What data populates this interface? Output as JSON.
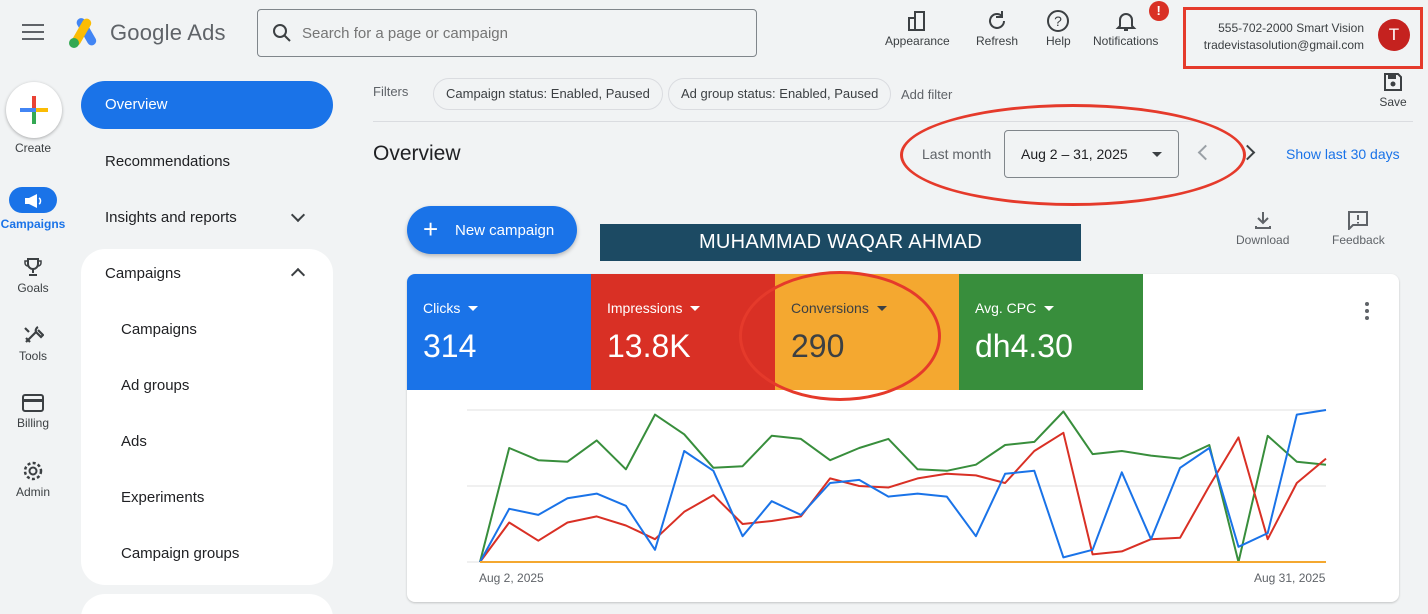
{
  "app": {
    "name": "Google Ads",
    "search_placeholder": "Search for a page or campaign"
  },
  "top_actions": [
    {
      "label": "Appearance",
      "icon": "appearance-icon"
    },
    {
      "label": "Refresh",
      "icon": "refresh-icon"
    },
    {
      "label": "Help",
      "icon": "help-icon"
    },
    {
      "label": "Notifications",
      "icon": "bell-icon",
      "badge": "!"
    }
  ],
  "account": {
    "line1": "555-702-2000 Smart Vision",
    "email": "tradevistasolution@gmail.com",
    "avatar_letter": "T"
  },
  "rail": {
    "create": "Create",
    "campaigns": "Campaigns",
    "goals": "Goals",
    "tools": "Tools",
    "billing": "Billing",
    "admin": "Admin"
  },
  "sidebar": {
    "overview": "Overview",
    "recommendations": "Recommendations",
    "insights": "Insights and reports",
    "campaigns_section": "Campaigns",
    "sub_items": [
      "Campaigns",
      "Ad groups",
      "Ads",
      "Experiments",
      "Campaign groups"
    ]
  },
  "filters": {
    "label": "Filters",
    "chips": [
      "Campaign status: Enabled, Paused",
      "Ad group status: Enabled, Paused"
    ],
    "add": "Add filter"
  },
  "save_label": "Save",
  "main": {
    "title": "Overview",
    "date_preset": "Last month",
    "date_range": "Aug 2 – 31, 2025",
    "show_last": "Show last 30 days",
    "new_campaign": "New campaign",
    "banner": "MUHAMMAD WAQAR AHMAD",
    "download": "Download",
    "feedback": "Feedback"
  },
  "colors": {
    "blue": "#1a73e8",
    "red": "#d93025",
    "orange": "#f4a830",
    "green": "#388e3c",
    "annotation": "#e53a2b"
  },
  "metrics": [
    {
      "name": "Clicks",
      "value": "314",
      "color": "#1a73e8"
    },
    {
      "name": "Impressions",
      "value": "13.8K",
      "color": "#d93025"
    },
    {
      "name": "Conversions",
      "value": "290",
      "color": "#f4a830"
    },
    {
      "name": "Avg. CPC",
      "value": "dh4.30",
      "color": "#388e3c"
    }
  ],
  "chart_data": {
    "type": "line",
    "x_start_label": "Aug 2, 2025",
    "x_end_label": "Aug 31, 2025",
    "grid": true,
    "ylim": [
      0,
      100
    ],
    "series": [
      {
        "name": "Clicks",
        "color": "#1a73e8",
        "values": [
          0,
          35,
          31,
          42,
          45,
          37,
          8,
          73,
          60,
          17,
          40,
          31,
          52,
          54,
          43,
          45,
          43,
          17,
          58,
          60,
          3,
          8,
          59,
          15,
          62,
          75,
          10,
          19,
          97,
          100
        ]
      },
      {
        "name": "Impressions",
        "color": "#d93025",
        "values": [
          0,
          26,
          14,
          26,
          30,
          24,
          15,
          33,
          44,
          25,
          27,
          30,
          55,
          50,
          49,
          55,
          58,
          57,
          52,
          73,
          85,
          5,
          7,
          15,
          16,
          50,
          82,
          15,
          52,
          68
        ]
      },
      {
        "name": "Conversions",
        "color": "#f4a830",
        "values": [
          0,
          0,
          0,
          0,
          0,
          0,
          0,
          0,
          0,
          0,
          0,
          0,
          0,
          0,
          0,
          0,
          0,
          0,
          0,
          0,
          0,
          0,
          0,
          0,
          0,
          0,
          0,
          0,
          0,
          0
        ]
      },
      {
        "name": "Avg. CPC",
        "color": "#388e3c",
        "values": [
          0,
          75,
          67,
          66,
          80,
          61,
          97,
          84,
          62,
          63,
          83,
          81,
          67,
          75,
          81,
          61,
          60,
          64,
          77,
          79,
          99,
          71,
          73,
          70,
          68,
          77,
          0,
          83,
          66,
          64
        ]
      }
    ]
  }
}
